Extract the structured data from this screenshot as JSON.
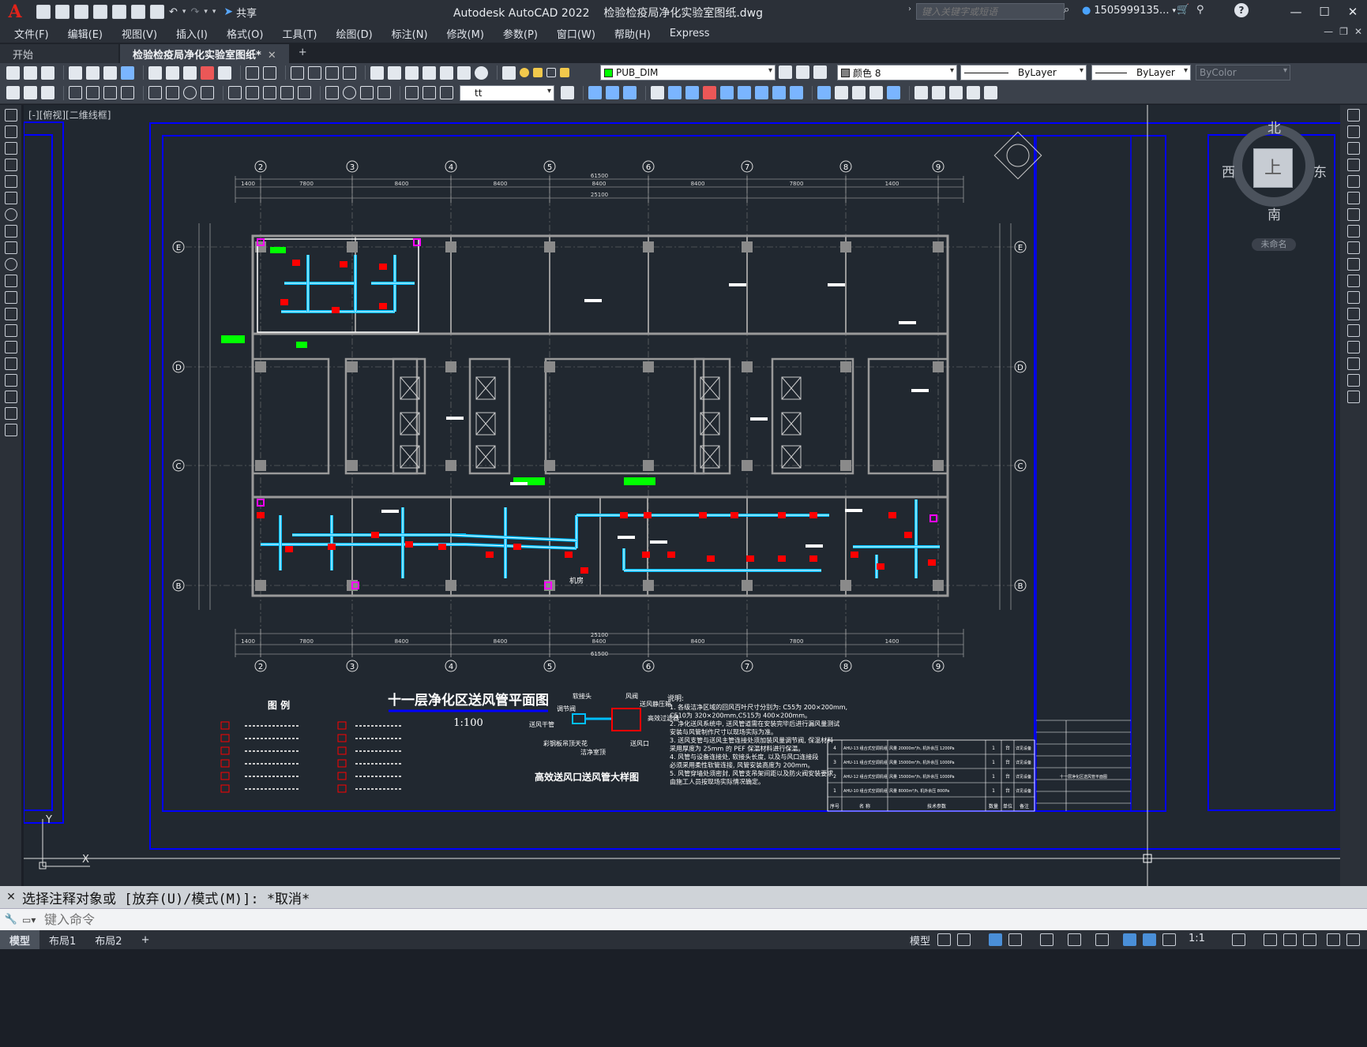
{
  "app": {
    "logo": "A",
    "title": "Autodesk AutoCAD 2022",
    "filename": "检验检疫局净化实验室图纸.dwg",
    "share": "共享",
    "search_placeholder": "键入关键字或短语",
    "user": "1505999135...",
    "help": "?"
  },
  "menu": [
    "文件(F)",
    "编辑(E)",
    "视图(V)",
    "插入(I)",
    "格式(O)",
    "工具(T)",
    "绘图(D)",
    "标注(N)",
    "修改(M)",
    "参数(P)",
    "窗口(W)",
    "帮助(H)",
    "Express"
  ],
  "tabs": [
    {
      "label": "开始"
    },
    {
      "label": "检验检疫局净化实验室图纸*"
    }
  ],
  "layers": {
    "current": "PUB_DIM",
    "color": "颜色 8",
    "linetype": "ByLayer",
    "lineweight": "ByLayer",
    "plotstyle": "ByColor",
    "textstyle": "tt"
  },
  "viewport": {
    "label": "[-][俯视][二维线框]"
  },
  "viewcube": {
    "north": "北",
    "south": "南",
    "west": "西",
    "east": "东",
    "face": "上",
    "wcs": "未命名"
  },
  "drawing": {
    "title": "十一层净化区送风管平面图",
    "scale": "1:100",
    "legend_title": "图 例",
    "detail_title": "高效送风口送风管大样图",
    "detail_labels": [
      "软接头",
      "调节阀",
      "送风干管",
      "彩钢板吊顶天花",
      "洁净室顶",
      "送风口",
      "风阀",
      "送风静压箱",
      "高效过滤器"
    ],
    "notes_title": "说明:",
    "notes": [
      "1. 各级洁净区域的回风百叶尺寸分别为: C55为 200×200mm,",
      "   C510为 320×200mm,C515为 400×200mm。",
      "2. 净化送风系统中, 送风管道需在安装完毕后进行漏风量测试",
      "   安装与风管制作尺寸以现场实际为准。",
      "3. 送风支管与送风主管连接处须加装风量调节阀, 保温材料",
      "   采用厚度为 25mm 的 PEF 保温材料进行保温。",
      "4. 风管与设备连接处, 软接头长度, 以及与风口连接段",
      "   必须采用柔性软管连接, 风管安装高度为 200mm。",
      "5. 风管穿墙处须密封, 风管支吊架间距以及防火阀安装要求",
      "   由施工人员按现场实际情况确定。"
    ],
    "axes_top": [
      "2",
      "3",
      "4",
      "5",
      "6",
      "7",
      "8",
      "9"
    ],
    "axes_side": [
      "E",
      "D",
      "C",
      "B"
    ],
    "dims_top": [
      "1400",
      "7800",
      "8400",
      "8400",
      "8400",
      "8400",
      "7800",
      "1400"
    ],
    "total_dim": "61500",
    "mid_dim": "25100",
    "room_label": "机房",
    "equip_table_header": [
      "序号",
      "名 称",
      "技术参数",
      "数量",
      "单位",
      "备注"
    ],
    "equip_rows": [
      [
        "4",
        "AHU-13 组合式空调机组",
        "风量 20000m³/h, 机外余压 1200Pa",
        "1",
        "台",
        "详见设备"
      ],
      [
        "3",
        "AHU-11 组合式空调机组",
        "风量 15000m³/h, 机外余压 1000Pa",
        "1",
        "台",
        "详见设备"
      ],
      [
        "2",
        "AHU-12 组合式空调机组",
        "风量 15000m³/h, 机外余压 1000Pa",
        "1",
        "台",
        "详见设备"
      ],
      [
        "1",
        "AHU-10 组合式空调机组",
        "风量 8000m³/h, 机外余压 800Pa",
        "1",
        "台",
        "详见设备"
      ]
    ],
    "titleblock_name": "十一层净化区送风管平面图"
  },
  "command": {
    "history": "选择注释对象或 [放弃(U)/模式(M)]: *取消*",
    "placeholder": "键入命令"
  },
  "layouts": [
    "模型",
    "布局1",
    "布局2",
    "+"
  ],
  "status": {
    "model": "模型",
    "scale": "1:1"
  },
  "colors": {
    "background": "#212830",
    "frame": "#0000ff",
    "duct": "#00bfff",
    "terminal": "#ff0000",
    "walls": "#9a9a9a",
    "fan": "#00ff00"
  }
}
